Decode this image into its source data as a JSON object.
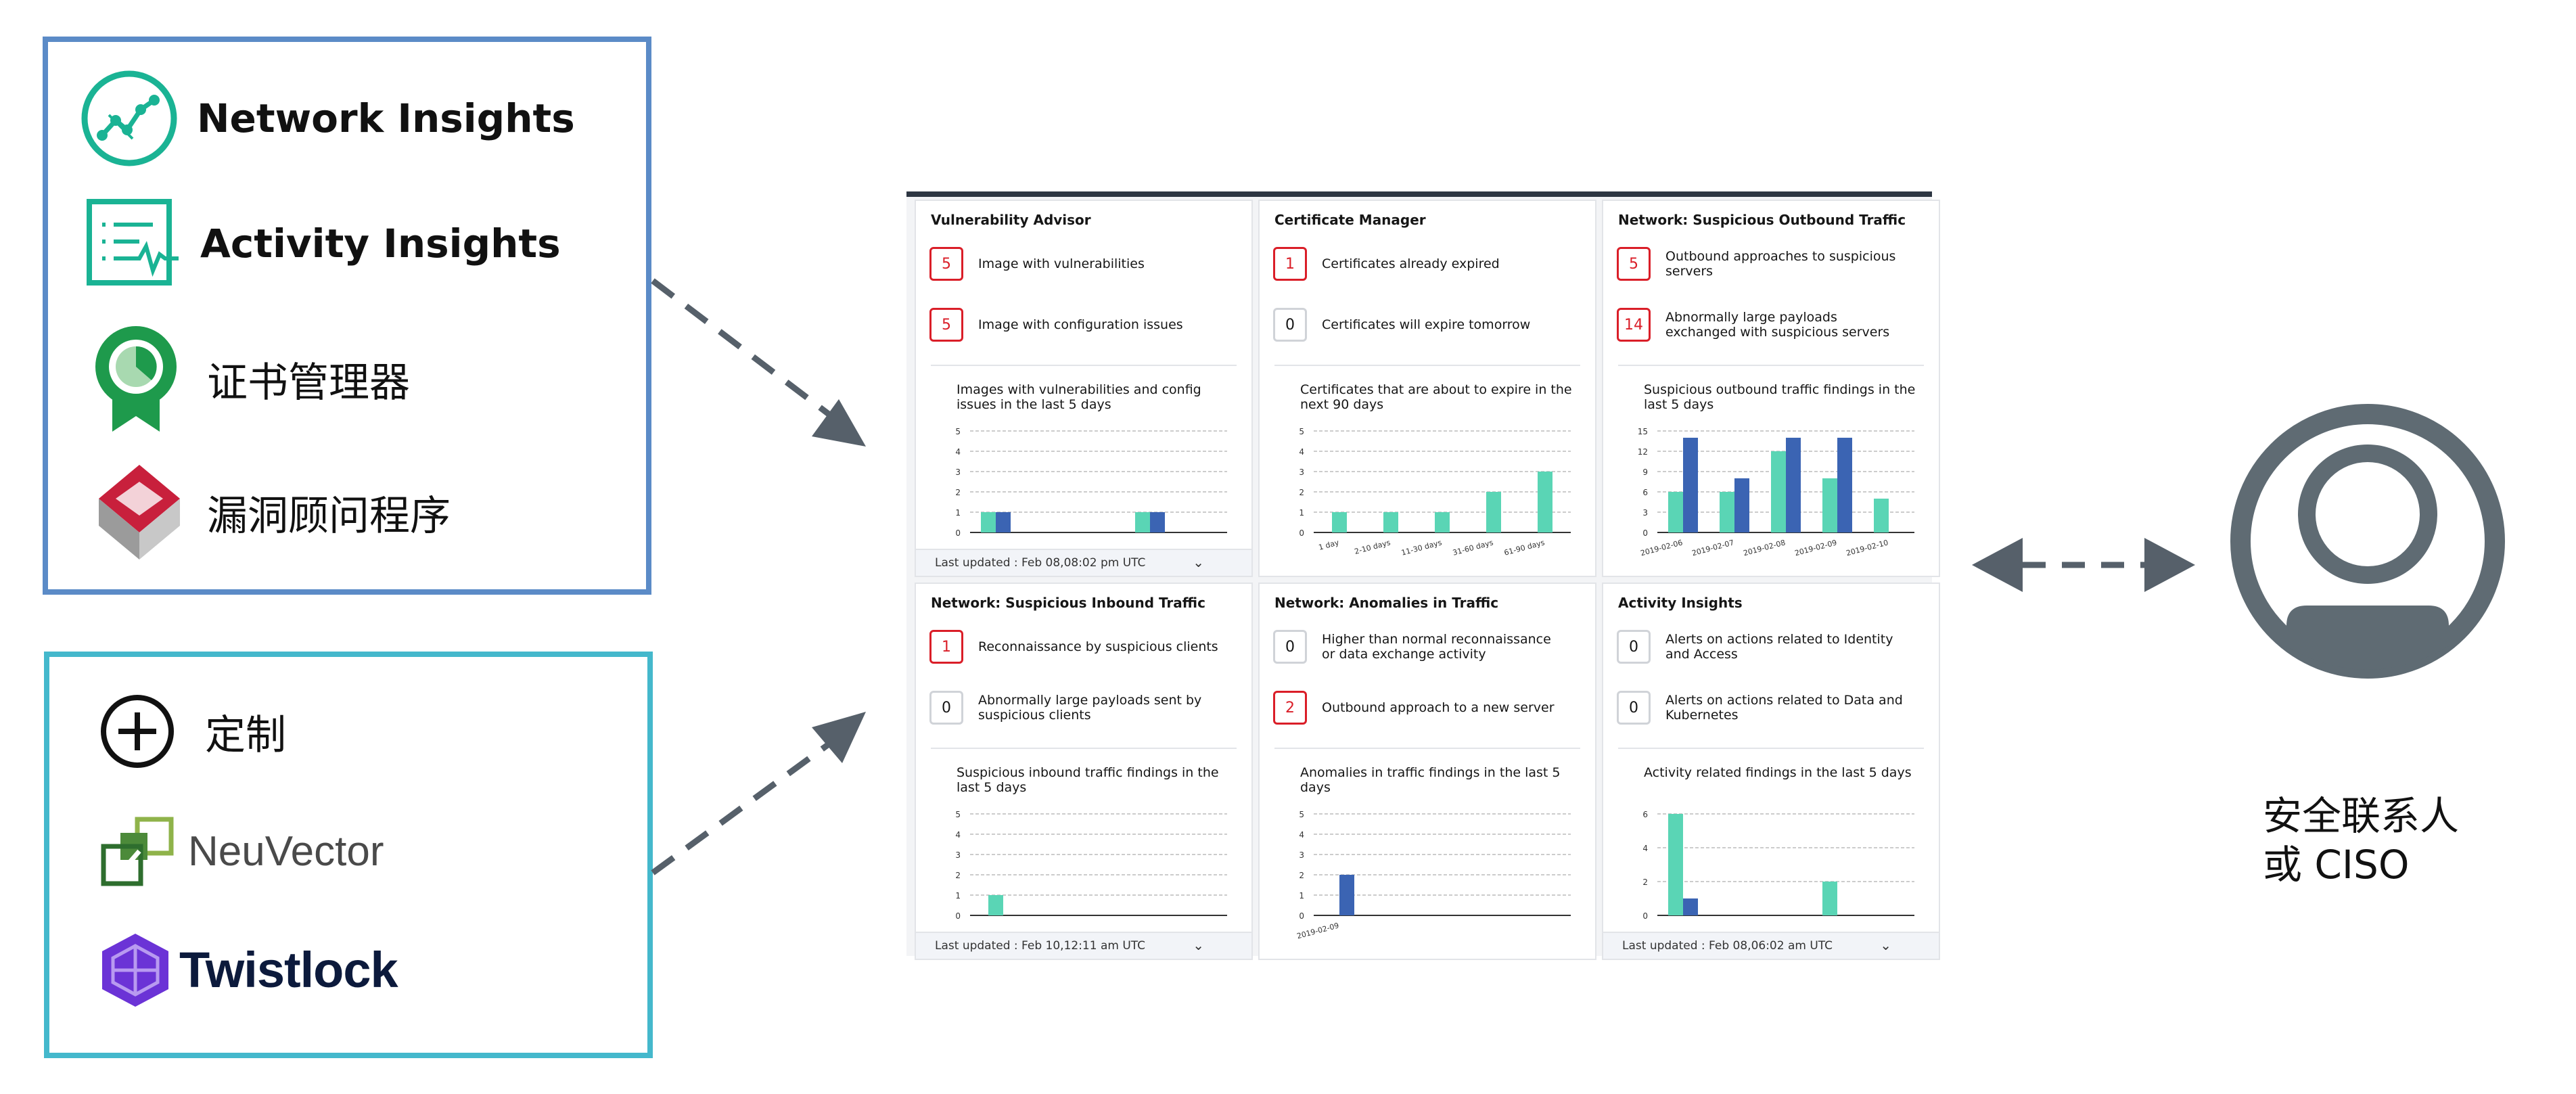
{
  "tools": {
    "items": [
      {
        "label": "Network Insights",
        "icon": "network-insights-icon",
        "color": "#1ab394"
      },
      {
        "label": "Activity Insights",
        "icon": "activity-insights-icon",
        "color": "#1ab394"
      },
      {
        "label": "证书管理器",
        "icon": "certificate-manager-icon",
        "color": "#1e9a4c"
      },
      {
        "label": "漏洞顾问程序",
        "icon": "vulnerability-advisor-icon",
        "color": "#c8203c"
      }
    ]
  },
  "extensions": {
    "items": [
      {
        "label": "定制",
        "icon": "plus-circle-icon"
      },
      {
        "label": "NeuVector",
        "icon": "neuvector-logo-icon",
        "color": "#6fa034"
      },
      {
        "label": "Twistlock",
        "icon": "twistlock-logo-icon",
        "color": "#6b33d6"
      }
    ]
  },
  "dashboard": {
    "panels": [
      {
        "title": "Vulnerability Advisor",
        "rows": [
          {
            "count": "5",
            "alert": true,
            "text": "Image with vulnerabilities"
          },
          {
            "count": "5",
            "alert": true,
            "text": "Image with configuration issues"
          }
        ],
        "chart_title": "Images with vulnerabilities and config issues in the last 5 days",
        "footer": "Last updated : Feb 08,08:02 pm UTC"
      },
      {
        "title": "Certificate Manager",
        "rows": [
          {
            "count": "1",
            "alert": true,
            "text": "Certificates already expired"
          },
          {
            "count": "0",
            "alert": false,
            "text": "Certificates will expire tomorrow"
          }
        ],
        "chart_title": "Certificates that are about to expire in the next 90 days",
        "footer": ""
      },
      {
        "title": "Network: Suspicious Outbound Traffic",
        "rows": [
          {
            "count": "5",
            "alert": true,
            "text": "Outbound approaches to suspicious servers"
          },
          {
            "count": "14",
            "alert": true,
            "text": "Abnormally large payloads exchanged with suspicious servers"
          }
        ],
        "chart_title": "Suspicious outbound traffic findings in the last 5 days",
        "footer": ""
      },
      {
        "title": "Network: Suspicious Inbound Traffic",
        "rows": [
          {
            "count": "1",
            "alert": true,
            "text": "Reconnaissance by suspicious clients"
          },
          {
            "count": "0",
            "alert": false,
            "text": "Abnormally large payloads sent by suspicious clients"
          }
        ],
        "chart_title": "Suspicious inbound traffic findings in the last 5 days",
        "footer": "Last updated : Feb 10,12:11 am UTC"
      },
      {
        "title": "Network: Anomalies in Traffic",
        "rows": [
          {
            "count": "0",
            "alert": false,
            "text": "Higher than normal reconnaissance or data exchange activity"
          },
          {
            "count": "2",
            "alert": true,
            "text": "Outbound approach to a new server"
          }
        ],
        "chart_title": "Anomalies in traffic findings in the last 5 days",
        "footer": ""
      },
      {
        "title": "Activity Insights",
        "rows": [
          {
            "count": "0",
            "alert": false,
            "text": "Alerts on actions related to Identity and Access"
          },
          {
            "count": "0",
            "alert": false,
            "text": "Alerts on actions related to Data and Kubernetes"
          }
        ],
        "chart_title": "Activity related findings in the last 5 days",
        "footer": "Last updated : Feb 08,06:02 am UTC"
      }
    ],
    "expand_glyph": "⌄"
  },
  "chart_data": [
    {
      "type": "bar",
      "categories": [
        "",
        ""
      ],
      "series": [
        {
          "values": [
            1,
            1
          ]
        },
        {
          "values": [
            1,
            1
          ]
        }
      ],
      "ylim": [
        0,
        5
      ],
      "yticks": [
        "0",
        "1",
        "2",
        "3",
        "4",
        "5"
      ]
    },
    {
      "type": "bar",
      "categories": [
        "1 day",
        "2-10 days",
        "11-30 days",
        "31-60 days",
        "61-90 days"
      ],
      "series": [
        {
          "values": [
            1,
            1,
            1,
            2,
            3
          ]
        }
      ],
      "ylim": [
        0,
        5
      ],
      "yticks": [
        "0",
        "1",
        "2",
        "3",
        "4",
        "5"
      ]
    },
    {
      "type": "bar",
      "categories": [
        "2019-02-06",
        "2019-02-07",
        "2019-02-08",
        "2019-02-09",
        "2019-02-10"
      ],
      "series": [
        {
          "values": [
            6,
            6,
            12,
            8,
            5
          ]
        },
        {
          "values": [
            14,
            8,
            14,
            14,
            0
          ]
        }
      ],
      "ylim": [
        0,
        15
      ],
      "yticks": [
        "0",
        "3",
        "6",
        "9",
        "12",
        "15"
      ]
    },
    {
      "type": "bar",
      "categories": [
        ""
      ],
      "series": [
        {
          "values": [
            1
          ]
        }
      ],
      "ylim": [
        0,
        5
      ],
      "yticks": [
        "0",
        "1",
        "2",
        "3",
        "4",
        "5"
      ]
    },
    {
      "type": "bar",
      "categories": [
        "2019-02-09"
      ],
      "series": [
        {
          "values": [
            0
          ]
        },
        {
          "values": [
            2
          ]
        }
      ],
      "ylim": [
        0,
        5
      ],
      "yticks": [
        "0",
        "1",
        "2",
        "3",
        "4",
        "5"
      ]
    },
    {
      "type": "bar",
      "categories": [
        "",
        ""
      ],
      "series": [
        {
          "values": [
            6,
            2
          ]
        },
        {
          "values": [
            1,
            0
          ]
        }
      ],
      "ylim": [
        0,
        6
      ],
      "yticks": [
        "0",
        "2",
        "4",
        "6"
      ]
    }
  ],
  "colors": {
    "teal": "#5ad5b5",
    "blue": "#3b64b3",
    "grid": "#999999",
    "alert": "#da1e28",
    "person": "#5f6b73"
  },
  "contact": {
    "line1": "安全联系人",
    "line2": "或 CISO"
  }
}
